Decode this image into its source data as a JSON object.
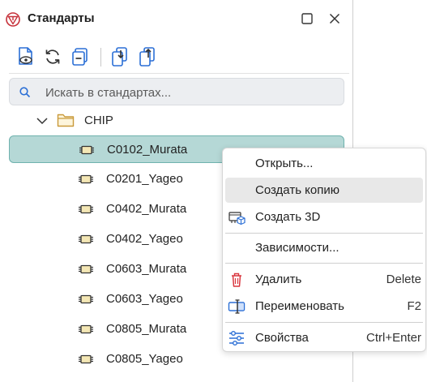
{
  "window": {
    "title": "Стандарты"
  },
  "toolbar": {
    "buttons": [
      {
        "name": "view-standard-icon"
      },
      {
        "name": "refresh-icon"
      },
      {
        "name": "collapse-all-icon"
      },
      {
        "name": "import-icon"
      },
      {
        "name": "export-icon"
      }
    ]
  },
  "search": {
    "placeholder": "Искать в стандартах...",
    "value": ""
  },
  "tree": {
    "folder": {
      "label": "CHIP",
      "expanded": true
    },
    "items": [
      {
        "label": "C0102_Murata",
        "selected": true
      },
      {
        "label": "C0201_Yageo"
      },
      {
        "label": "C0402_Murata"
      },
      {
        "label": "C0402_Yageo"
      },
      {
        "label": "C0603_Murata"
      },
      {
        "label": "C0603_Yageo"
      },
      {
        "label": "C0805_Murata"
      },
      {
        "label": "C0805_Yageo"
      }
    ]
  },
  "context_menu": {
    "items": [
      {
        "label": "Открыть...",
        "shortcut": "",
        "icon": ""
      },
      {
        "label": "Создать копию",
        "shortcut": "",
        "icon": "",
        "hovered": true
      },
      {
        "label": "Создать 3D",
        "shortcut": "",
        "icon": "create-3d-icon"
      },
      {
        "label": "Зависимости...",
        "shortcut": "",
        "icon": ""
      },
      {
        "label": "Удалить",
        "shortcut": "Delete",
        "icon": "trash-icon"
      },
      {
        "label": "Переименовать",
        "shortcut": "F2",
        "icon": "rename-icon"
      },
      {
        "label": "Свойства",
        "shortcut": "Ctrl+Enter",
        "icon": "properties-icon"
      }
    ]
  },
  "colors": {
    "accent": "#2b6fd6",
    "selection": "#b5d8d6",
    "selection_border": "#6fb2ae",
    "danger": "#d9363e",
    "logo": "#c6313a"
  }
}
